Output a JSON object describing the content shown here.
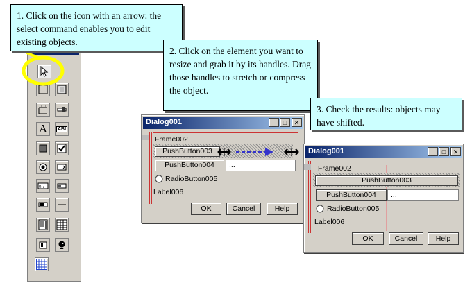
{
  "callouts": {
    "step1": "1. Click on the icon with an arrow: the select command enables you to edit existing objects.",
    "step2": "2. Click on the element you want to resize and grab it by its handles.  Drag those handles to stretch or compress the object.",
    "step3": "3. Check the results: objects may have shifted."
  },
  "toolbox": {
    "tools": [
      "select-arrow",
      "frame",
      "group-box",
      "tab",
      "scroll",
      "text-label",
      "edit-field",
      "push-button",
      "checkbox",
      "radio-button",
      "spin-button",
      "range-slider",
      "horizontal-scroll",
      "progress",
      "horizontal-line",
      "list",
      "grid",
      "image",
      "ole-object",
      "table-grid"
    ],
    "text_icon": "A",
    "field_icon": "ABI"
  },
  "dialog_before": {
    "title": "Dialog001",
    "frame_label": "Frame002",
    "button_a": "PushButton003",
    "button_b": "PushButton004",
    "field_value": "...",
    "radio_label": "RadioButton005",
    "label": "Label006",
    "ok": "OK",
    "cancel": "Cancel",
    "help": "Help",
    "win_min": "_",
    "win_max": "□",
    "win_close": "✕"
  },
  "dialog_after": {
    "title": "Dialog001",
    "frame_label": "Frame002",
    "button_a": "PushButton003",
    "button_b": "PushButton004",
    "field_value": "...",
    "radio_label": "RadioButton005",
    "label": "Label006",
    "ok": "OK",
    "cancel": "Cancel",
    "help": "Help",
    "win_min": "_",
    "win_max": "□",
    "win_close": "✕"
  },
  "colors": {
    "callout_bg": "#ccffff",
    "titlebar": "#0a246a",
    "highlight": "#ffff00",
    "arrow": "#3333cc",
    "guide": "#cc3333"
  }
}
